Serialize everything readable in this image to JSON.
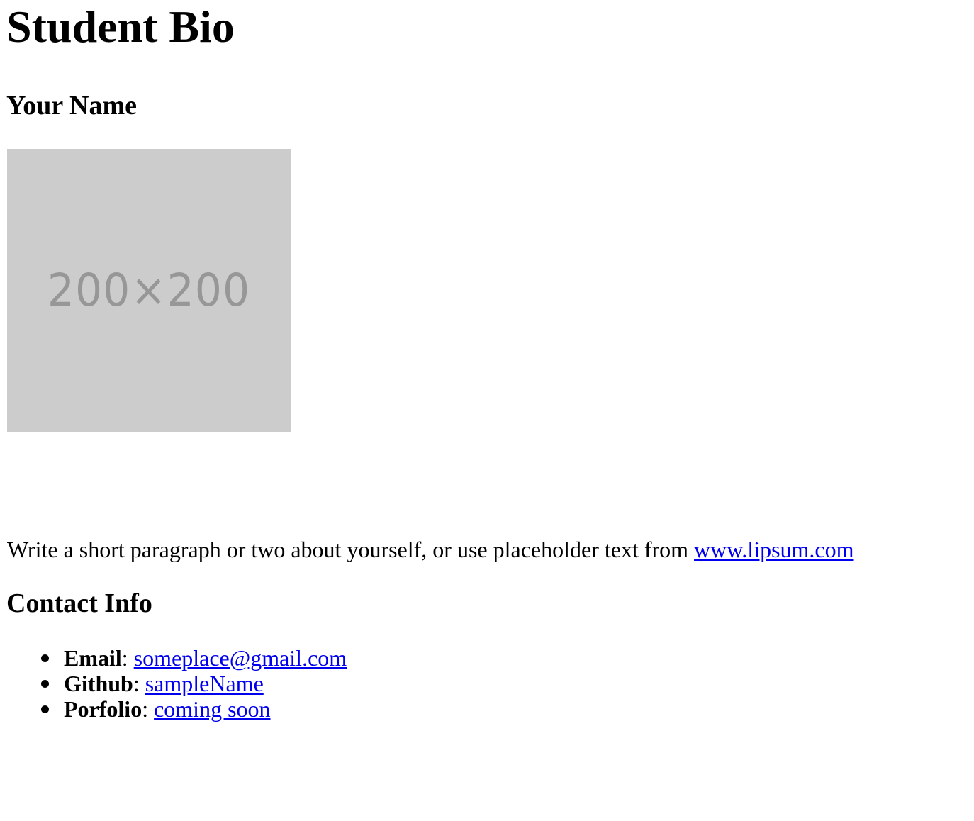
{
  "header": {
    "title": "Student Bio",
    "name": "Your Name"
  },
  "photo": {
    "placeholder_label": "200×200"
  },
  "bio": {
    "text": "Write a short paragraph or two about yourself, or use placeholder text from ",
    "link_text": "www.lipsum.com"
  },
  "contact": {
    "heading": "Contact Info",
    "separator": ": ",
    "items": [
      {
        "key": "Email",
        "value": "someplace@gmail.com"
      },
      {
        "key": "Github",
        "value": "sampleName"
      },
      {
        "key": "Porfolio",
        "value": "coming soon"
      }
    ]
  },
  "colors": {
    "link": "#0000ee",
    "photo_bg": "#cccccc",
    "photo_text": "#979797"
  }
}
